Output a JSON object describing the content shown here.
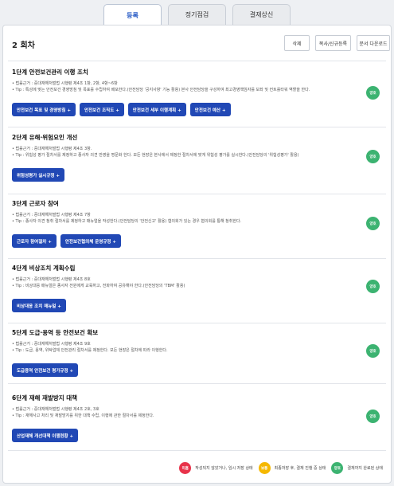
{
  "tabs": [
    "등록",
    "정기점검",
    "결재상신"
  ],
  "round_title": "2 회차",
  "header_buttons": {
    "delete": "삭제",
    "copy": "복사/신규등록",
    "download": "문서 다운로드"
  },
  "colors": {
    "primary": "#2148b5",
    "green": "#3cb371",
    "red": "#e8334a",
    "yellow": "#f5b800"
  },
  "sections": [
    {
      "title": "1단계 안전보건관리 이행 조치",
      "lines": [
        "법률근거 : 중대재해처벌법 시행령 제4조 1항, 2항, 4항~6항",
        "Tip : 특성에 맞는 안전보건 경영방침 및 목표를 수립하여 배포한다.(안전담당 '공지사항' 기능 활용) 본사 안전담당을 구성하여 최고경영책임자를 보좌 및 컨트롤타워 역할을 한다."
      ],
      "buttons": [
        "안전보건 목표 및 경영방침 +",
        "안전보건 조직도 +",
        "안전보건 세부 이행계획 +",
        "안전보건 예산 +"
      ],
      "badge": "양호"
    },
    {
      "title": "2단계 유해·위험요인 개선",
      "lines": [
        "법률근거 : 중대재해처벌법 시행령 제4조 3항.",
        "Tip : 위험성 평가 절차서를 제정하고 종사자 의견 반영을 명문화 한다. 모든 현장은 본사에서 제정한 절차서에 맞게 위험성 평가를 실시한다.(안전담당의 '위험성평가' 활용)"
      ],
      "buttons": [
        "위험성평가 실시규정 +"
      ],
      "badge": "양호"
    },
    {
      "title": "3단계 근로자 참여",
      "lines": [
        "법률근거 : 중대재해처벌법 시행령 제4조 7항",
        "Tip : 종사자 의견 청취 절차서를 제정하고 매뉴얼을 작성한다.(안전담당의 '안전신고' 활용) 협의회가 있는 경우 협의회를 통해 청취한다."
      ],
      "buttons": [
        "근로자 참여절차 +",
        "안전보건협의체 운영규정 +"
      ],
      "badge": "양호"
    },
    {
      "title": "4단계 비상조치 계획수립",
      "lines": [
        "법률근거 : 중대재해처벌법 시행령 제4조 8호",
        "Tip : 비상대응 매뉴얼은 종사자 전원에게 교육하고, 전파하여 공유해야 한다.(안전담당의 'TBM' 활용)"
      ],
      "buttons": [
        "비상대응 조치 매뉴얼 +"
      ],
      "badge": "양호"
    },
    {
      "title": "5단계 도급·용역 등 안전보건 확보",
      "lines": [
        "법률근거 : 중대재해처벌법 시행령 제4조 9호",
        "Tip : 도급, 용역, 위탁업체 안전관리 절차서를 제정한다. 모든 현장은 절차에 따라 이행한다."
      ],
      "buttons": [
        "도급용역 안전보건 평가규정 +"
      ],
      "badge": "양호"
    },
    {
      "title": "6단계 재해 재발방지 대책",
      "lines": [
        "법률근거 : 중대재해처벌법 시행령 제4조 2호, 3호",
        "Tip : 재해사고 처리 및 재발방지를 위한 대책 수립, 이행에 관한 절차서를 제정한다."
      ],
      "buttons": [
        "산업재해 개선대책 이행현황 +"
      ],
      "badge": "양호"
    }
  ],
  "legend": [
    {
      "badge": "미흡",
      "text": "작성되지 않았거나, 임시 저장 상태"
    },
    {
      "badge": "보통",
      "text": "최종저장 후, 결재 진행 중 상태"
    },
    {
      "badge": "양호",
      "text": "결재까지 완료된 상태"
    }
  ]
}
